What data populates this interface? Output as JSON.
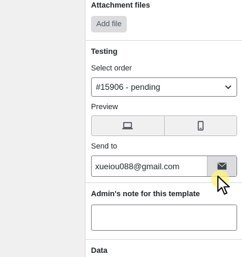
{
  "attachments": {
    "title": "Attachment files",
    "add_button": "Add file"
  },
  "testing": {
    "title": "Testing",
    "select_order_label": "Select order",
    "select_order_value": "#15906 - pending",
    "preview_label": "Preview",
    "preview_options": [
      {
        "icon": "desktop-icon",
        "selected": true
      },
      {
        "icon": "mobile-icon",
        "selected": false
      }
    ],
    "send_to_label": "Send to",
    "send_to_value": "xueiou088@gmail.com",
    "send_icon": "envelope-icon"
  },
  "admin_note": {
    "title": "Admin's note for this template",
    "value": ""
  },
  "data_section": {
    "title": "Data"
  },
  "colors": {
    "page_bg": "#f0f0f1",
    "panel_bg": "#ffffff",
    "border": "#dcdcde",
    "cursor_highlight": "#fff678"
  }
}
